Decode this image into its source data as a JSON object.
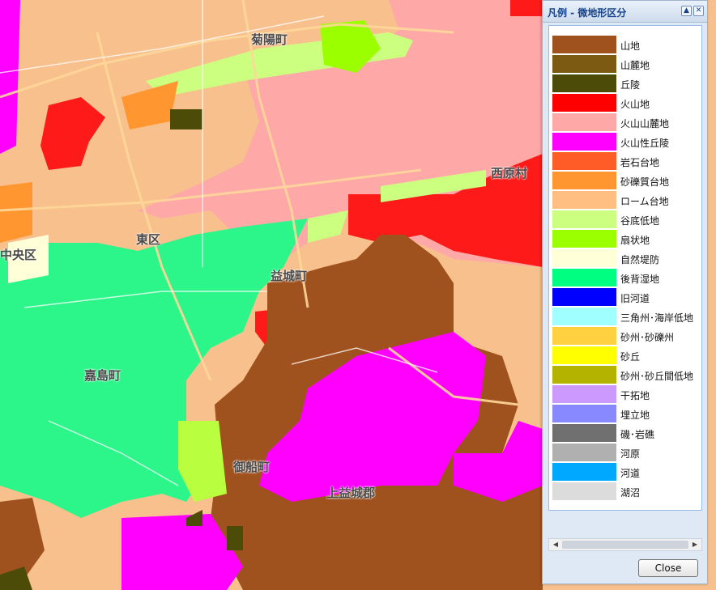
{
  "map": {
    "places": [
      "菊陽町",
      "東区",
      "益城町",
      "嘉島町",
      "御船町",
      "上益城郡",
      "西原村",
      "中央区"
    ]
  },
  "legend": {
    "title": "凡例 - 微地形区分",
    "collapse_icon": "chevron-up-icon",
    "close_icon": "close-icon",
    "items": [
      {
        "label": "山地",
        "color": "#a0521e"
      },
      {
        "label": "山麓地",
        "color": "#7d5a12"
      },
      {
        "label": "丘陵",
        "color": "#4c4c08"
      },
      {
        "label": "火山地",
        "color": "#ff0000"
      },
      {
        "label": "火山山麓地",
        "color": "#ffa8a8"
      },
      {
        "label": "火山性丘陵",
        "color": "#ff00ff"
      },
      {
        "label": "岩石台地",
        "color": "#ff5c28"
      },
      {
        "label": "砂礫質台地",
        "color": "#ff9630"
      },
      {
        "label": "ローム台地",
        "color": "#ffbe82"
      },
      {
        "label": "谷底低地",
        "color": "#ccff80"
      },
      {
        "label": "扇状地",
        "color": "#9bff00"
      },
      {
        "label": "自然堤防",
        "color": "#ffffd8"
      },
      {
        "label": "後背湿地",
        "color": "#00ff80"
      },
      {
        "label": "旧河道",
        "color": "#0000ff"
      },
      {
        "label": "三角州･海岸低地",
        "color": "#a0ffff"
      },
      {
        "label": "砂州･砂礫州",
        "color": "#ffd040"
      },
      {
        "label": "砂丘",
        "color": "#ffff00"
      },
      {
        "label": "砂州･砂丘間低地",
        "color": "#b4b400"
      },
      {
        "label": "干拓地",
        "color": "#cc99ff"
      },
      {
        "label": "埋立地",
        "color": "#8888ff"
      },
      {
        "label": "磯･岩礁",
        "color": "#707070"
      },
      {
        "label": "河原",
        "color": "#b0b0b0"
      },
      {
        "label": "河道",
        "color": "#00a8ff"
      },
      {
        "label": "湖沼",
        "color": "#dcdcdc"
      }
    ],
    "close_label": "Close"
  }
}
